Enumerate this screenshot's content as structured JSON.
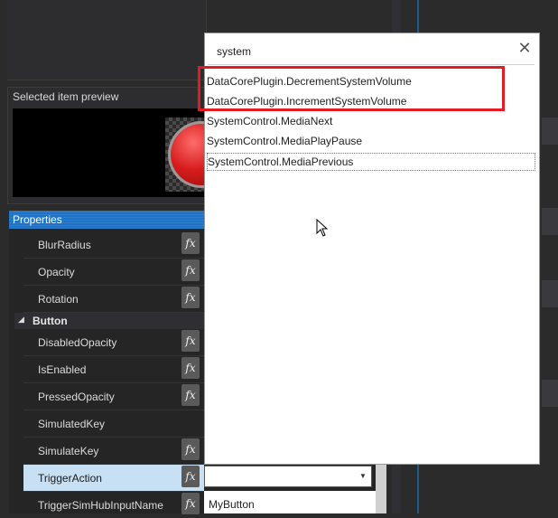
{
  "preview": {
    "title": "Selected item preview"
  },
  "properties": {
    "title": "Properties",
    "rows": [
      {
        "label": "BlurRadius",
        "fx": true
      },
      {
        "label": "Opacity",
        "fx": true
      },
      {
        "label": "Rotation",
        "fx": true
      }
    ],
    "section": {
      "label": "Button",
      "arrow": "◢"
    },
    "button_rows": [
      {
        "label": "DisabledOpacity",
        "fx": true
      },
      {
        "label": "IsEnabled",
        "fx": true
      },
      {
        "label": "PressedOpacity",
        "fx": true
      },
      {
        "label": "SimulatedKey",
        "fx": false
      },
      {
        "label": "SimulateKey",
        "fx": true
      },
      {
        "label": "TriggerAction",
        "fx": true
      },
      {
        "label": "TriggerSimHubInputName",
        "fx": true
      }
    ],
    "fx_symbol": "fx",
    "trigger_action_value": "",
    "input_name_value": "MyButton",
    "combo_arrow": "▼"
  },
  "popup": {
    "search_value": "system",
    "close_symbol": "✕",
    "results": [
      "DataCorePlugin.DecrementSystemVolume",
      "DataCorePlugin.IncrementSystemVolume",
      "SystemControl.MediaNext",
      "SystemControl.MediaPlayPause",
      "SystemControl.MediaPrevious"
    ]
  },
  "colors": {
    "accent": "#1f73c6",
    "highlight": "#e31b23",
    "selected_row": "#c7e0f4"
  }
}
